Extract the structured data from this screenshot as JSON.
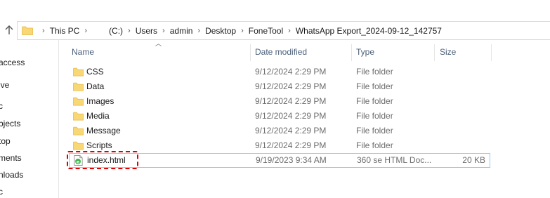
{
  "address": {
    "crumbs": [
      "This PC",
      "(C:)",
      "Users",
      "admin",
      "Desktop",
      "FoneTool",
      "WhatsApp Export_2024-09-12_142757"
    ]
  },
  "nav_pane": {
    "items": [
      "access",
      "ive",
      "c",
      "bjects",
      "top",
      "ments",
      "nloads",
      "c"
    ]
  },
  "columns": {
    "name": "Name",
    "date": "Date modified",
    "type": "Type",
    "size": "Size"
  },
  "files": [
    {
      "name": "CSS",
      "date": "9/12/2024 2:29 PM",
      "type": "File folder",
      "size": "",
      "icon": "folder-icon"
    },
    {
      "name": "Data",
      "date": "9/12/2024 2:29 PM",
      "type": "File folder",
      "size": "",
      "icon": "folder-icon"
    },
    {
      "name": "Images",
      "date": "9/12/2024 2:29 PM",
      "type": "File folder",
      "size": "",
      "icon": "folder-icon"
    },
    {
      "name": "Media",
      "date": "9/12/2024 2:29 PM",
      "type": "File folder",
      "size": "",
      "icon": "folder-icon"
    },
    {
      "name": "Message",
      "date": "9/12/2024 2:29 PM",
      "type": "File folder",
      "size": "",
      "icon": "folder-icon"
    },
    {
      "name": "Scripts",
      "date": "9/12/2024 2:29 PM",
      "type": "File folder",
      "size": "",
      "icon": "folder-icon"
    },
    {
      "name": "index.html",
      "date": "9/19/2023 9:34 AM",
      "type": "360 se HTML Doc...",
      "size": "20 KB",
      "icon": "html-file-icon"
    }
  ],
  "colors": {
    "folder": "#f8d775",
    "folder_dark": "#e8b84a",
    "highlight": "#e00000",
    "selection_border": "#99c9ef",
    "header_text": "#4c607a"
  }
}
